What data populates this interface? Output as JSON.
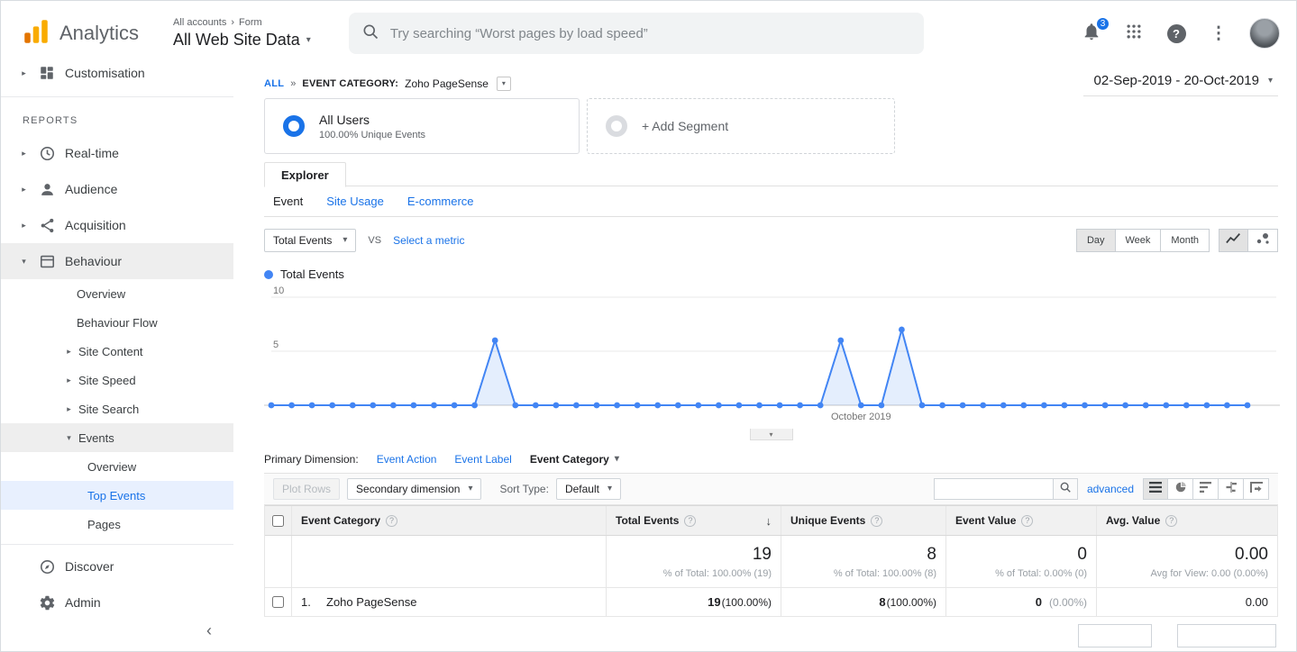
{
  "header": {
    "product": "Analytics",
    "breadcrumb": {
      "account": "All accounts",
      "sep": "›",
      "page": "Form"
    },
    "view_name": "All Web Site Data",
    "search_placeholder": "Try searching “Worst pages by load speed”",
    "notification_count": "3"
  },
  "sidebar": {
    "customisation": "Customisation",
    "reports_label": "REPORTS",
    "realtime": "Real-time",
    "audience": "Audience",
    "acquisition": "Acquisition",
    "behaviour": "Behaviour",
    "behaviour_children": {
      "overview": "Overview",
      "flow": "Behaviour Flow",
      "site_content": "Site Content",
      "site_speed": "Site Speed",
      "site_search": "Site Search",
      "events": "Events"
    },
    "events_children": {
      "overview": "Overview",
      "top_events": "Top Events",
      "pages": "Pages"
    },
    "discover": "Discover",
    "admin": "Admin"
  },
  "report": {
    "filter": {
      "all": "ALL",
      "sep": "»",
      "label": "EVENT CATEGORY:",
      "value": "Zoho PageSense"
    },
    "date_range": "02-Sep-2019 - 20-Oct-2019",
    "segments": {
      "all_users": "All Users",
      "all_users_detail": "100.00% Unique Events",
      "add_segment": "+ Add Segment"
    },
    "explorer_tab": "Explorer",
    "subtabs": {
      "event": "Event",
      "site_usage": "Site Usage",
      "ecommerce": "E-commerce"
    },
    "metric_picker": {
      "selected": "Total Events",
      "vs": "VS",
      "compare": "Select a metric"
    },
    "granularity": {
      "day": "Day",
      "week": "Week",
      "month": "Month"
    },
    "legend_label": "Total Events",
    "primary_dimension": {
      "label": "Primary Dimension:",
      "options": [
        "Event Action",
        "Event Label",
        "Event Category"
      ]
    },
    "toolbar": {
      "plot_rows": "Plot Rows",
      "secondary_dimension": "Secondary dimension",
      "sort_type_label": "Sort Type:",
      "sort_type_value": "Default",
      "advanced": "advanced"
    },
    "table": {
      "headers": [
        "Event Category",
        "Total Events",
        "Unique Events",
        "Event Value",
        "Avg. Value"
      ],
      "summary": {
        "total_events": "19",
        "total_events_note": "% of Total: 100.00% (19)",
        "unique_events": "8",
        "unique_events_note": "% of Total: 100.00% (8)",
        "event_value": "0",
        "event_value_note": "% of Total: 0.00% (0)",
        "avg_value": "0.00",
        "avg_value_note": "Avg for View: 0.00 (0.00%)"
      },
      "rows": [
        {
          "index": "1.",
          "category": "Zoho PageSense",
          "total_events": "19",
          "total_events_pct": "(100.00%)",
          "unique_events": "8",
          "unique_events_pct": "(100.00%)",
          "event_value": "0",
          "event_value_pct": "(0.00%)",
          "avg_value": "0.00"
        }
      ]
    }
  },
  "chart_data": {
    "type": "line",
    "title": "Total Events by day",
    "series": [
      {
        "name": "Total Events",
        "values": [
          0,
          0,
          0,
          0,
          0,
          0,
          0,
          0,
          0,
          0,
          0,
          6,
          0,
          0,
          0,
          0,
          0,
          0,
          0,
          0,
          0,
          0,
          0,
          0,
          0,
          0,
          0,
          0,
          6,
          0,
          0,
          7,
          0,
          0,
          0,
          0,
          0,
          0,
          0,
          0,
          0,
          0,
          0,
          0,
          0,
          0,
          0,
          0,
          0
        ]
      }
    ],
    "x_unit": "day",
    "x_range": [
      "02-Sep-2019",
      "20-Oct-2019"
    ],
    "x_axis_annotation": {
      "label": "October 2019",
      "index": 29
    },
    "ylim": [
      0,
      10
    ],
    "yticks": [
      5,
      10
    ],
    "grid": true,
    "legend_position": "top-left",
    "color": "#4285f4",
    "fill": "rgba(66,133,244,0.14)",
    "notable_points": [
      {
        "date": "13-Sep-2019",
        "value": 6
      },
      {
        "date": "30-Sep-2019",
        "value": 6
      },
      {
        "date": "03-Oct-2019",
        "value": 7
      }
    ]
  }
}
